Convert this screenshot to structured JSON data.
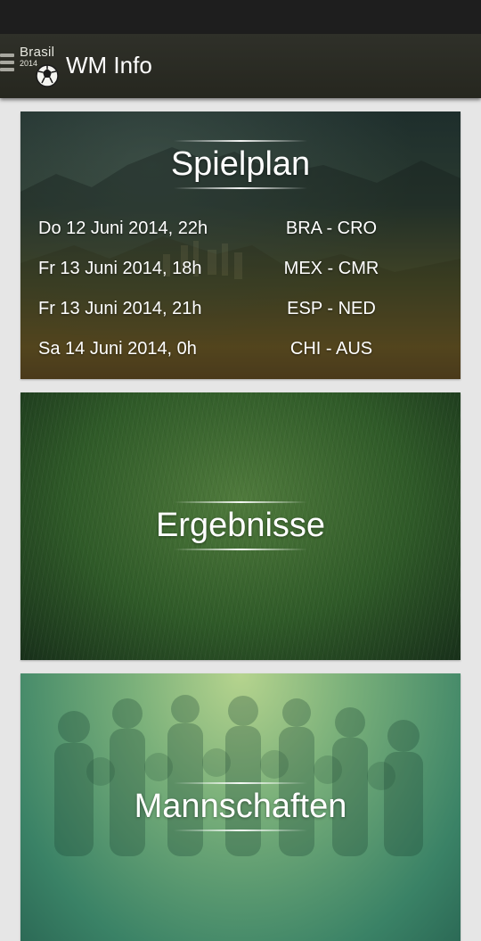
{
  "app": {
    "title": "WM Info",
    "logo_line1": "Brasil",
    "logo_line2": "2014"
  },
  "icons": {
    "menu": "hamburger-menu-icon",
    "logo": "football-icon"
  },
  "cards": {
    "spielplan": {
      "title": "Spielplan",
      "fixtures": [
        {
          "date": "Do 12 Juni 2014, 22h",
          "match": "BRA - CRO"
        },
        {
          "date": "Fr 13 Juni 2014, 18h",
          "match": "MEX - CMR"
        },
        {
          "date": "Fr 13 Juni 2014, 21h",
          "match": "ESP - NED"
        },
        {
          "date": "Sa 14 Juni 2014, 0h",
          "match": "CHI - AUS"
        }
      ]
    },
    "ergebnisse": {
      "title": "Ergebnisse"
    },
    "mannschaften": {
      "title": "Mannschaften"
    }
  },
  "colors": {
    "app_bar": "#2b2c24",
    "status_bar": "#1e1e1e",
    "page_background": "#e6e6e6",
    "text": "#ffffff"
  }
}
